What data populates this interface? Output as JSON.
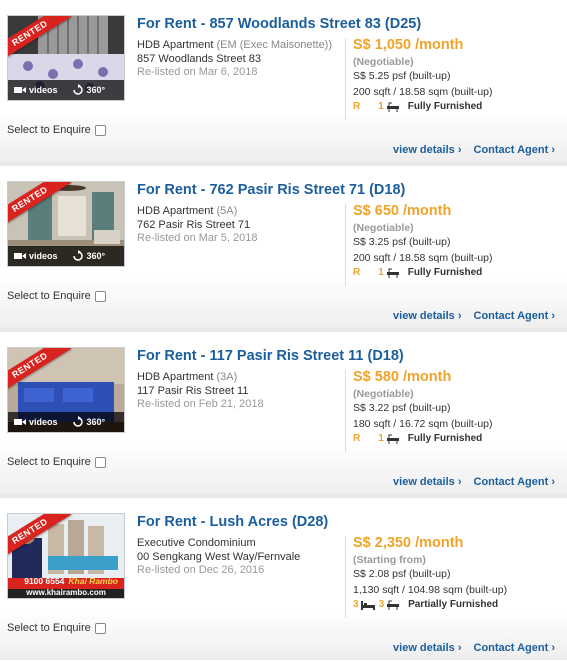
{
  "listings": [
    {
      "ribbon": "RENTED",
      "title": "For Rent - 857 Woodlands Street 83 (D25)",
      "type": "HDB Apartment",
      "subtype": "(EM (Exec Maisonette))",
      "address": "857 Woodlands Street 83",
      "listed": "Re-listed on Mar 6, 2018",
      "price": "S$ 1,050 /month",
      "price_note": "(Negotiable)",
      "psf": "S$ 5.25 psf (built-up)",
      "size": "200 sqft / 18.58 sqm (built-up)",
      "room_code": "R",
      "baths": "1",
      "furnishing": "Fully Furnished",
      "videos_label": "videos",
      "view360_label": "360°",
      "enquire_label": "Select to Enquire",
      "view_details": "view details ›",
      "contact_agent": "Contact Agent ›"
    },
    {
      "ribbon": "RENTED",
      "title": "For Rent - 762 Pasir Ris Street 71 (D18)",
      "type": "HDB Apartment",
      "subtype": "(5A)",
      "address": "762 Pasir Ris Street 71",
      "listed": "Re-listed on Mar 5, 2018",
      "price": "S$ 650 /month",
      "price_note": "(Negotiable)",
      "psf": "S$ 3.25 psf (built-up)",
      "size": "200 sqft / 18.58 sqm (built-up)",
      "room_code": "R",
      "baths": "1",
      "furnishing": "Fully Furnished",
      "videos_label": "videos",
      "view360_label": "360°",
      "enquire_label": "Select to Enquire",
      "view_details": "view details ›",
      "contact_agent": "Contact Agent ›"
    },
    {
      "ribbon": "RENTED",
      "title": "For Rent - 117 Pasir Ris Street 11 (D18)",
      "type": "HDB Apartment",
      "subtype": "(3A)",
      "address": "117 Pasir Ris Street 11",
      "listed": "Re-listed on Feb 21, 2018",
      "price": "S$ 580 /month",
      "price_note": "(Negotiable)",
      "psf": "S$ 3.22 psf (built-up)",
      "size": "180 sqft / 16.72 sqm (built-up)",
      "room_code": "R",
      "baths": "1",
      "furnishing": "Fully Furnished",
      "videos_label": "videos",
      "view360_label": "360°",
      "enquire_label": "Select to Enquire",
      "view_details": "view details ›",
      "contact_agent": "Contact Agent ›"
    },
    {
      "ribbon": "RENTED",
      "title": "For Rent - Lush Acres (D28)",
      "type": "Executive Condominium",
      "subtype": "",
      "address": "00 Sengkang West Way/Fernvale",
      "listed": "Re-listed on Dec 26, 2016",
      "price": "S$ 2,350 /month",
      "price_note": "(Starting from)",
      "psf": "S$ 2.08 psf (built-up)",
      "size": "1,130 sqft / 104.98 sqm (built-up)",
      "beds": "3",
      "baths": "3",
      "furnishing": "Partially Furnished",
      "agent_phone": "9100 6554",
      "agent_name": "Khai Rambo",
      "agent_site": "www.khairambo.com",
      "enquire_label": "Select to Enquire",
      "view_details": "view details ›",
      "contact_agent": "Contact Agent ›"
    }
  ],
  "colors": {
    "title_blue": "#1b5e9e",
    "price_orange": "#f0a32a",
    "ribbon_red": "#d8231f"
  }
}
